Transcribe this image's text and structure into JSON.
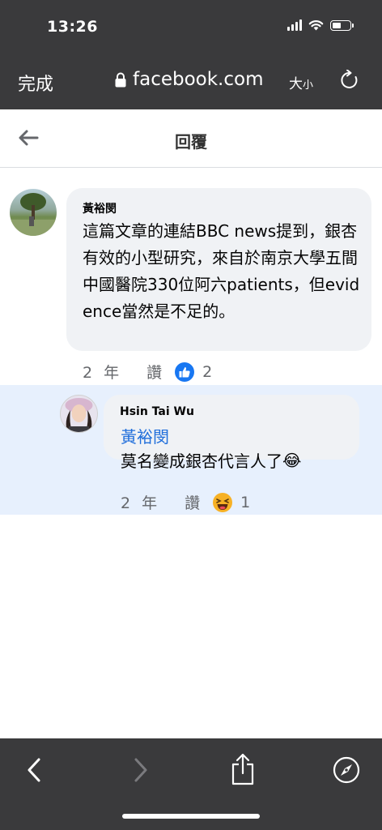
{
  "status_bar": {
    "time": "13:26",
    "battery_level": 0.55
  },
  "browser": {
    "done_label": "完成",
    "url": "facebook.com",
    "text_size_large": "大",
    "text_size_small": "小"
  },
  "header": {
    "title": "回覆"
  },
  "comments": [
    {
      "author": "黃裕閔",
      "text": "這篇文章的連結BBC news提到，銀杏有效的小型研究，來自於南京大學五間中國醫院330位阿六patients，但evidence當然是不足的。",
      "time": "2 年",
      "like_label": "讚",
      "reaction_icon": "like-icon",
      "reaction_count": "2"
    },
    {
      "author": "Hsin Tai Wu",
      "mention": "黃裕閔",
      "text": "莫名變成銀杏代言人了",
      "emoji": "😂",
      "time": "2 年",
      "like_label": "讚",
      "reaction_icon": "haha-icon",
      "reaction_count": "1"
    }
  ],
  "colors": {
    "chrome": "#3a3a3c",
    "bubble": "#f0f2f5",
    "reply_highlight": "#e7f0fd",
    "mention": "#216fdb",
    "like_blue": "#1877f2"
  }
}
